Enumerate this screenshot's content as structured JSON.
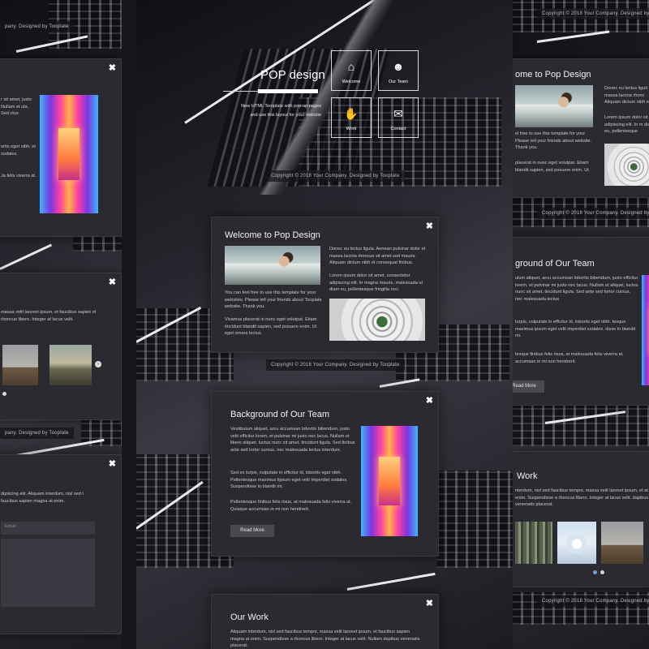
{
  "hero": {
    "title": "POP design",
    "tagline_1": "New HTML Template with pop up pages",
    "tagline_2": "and use this layout for your website",
    "nav": [
      {
        "label": "Welcome",
        "icon": "home-icon"
      },
      {
        "label": "Our Team",
        "icon": "users-icon"
      },
      {
        "label": "Work",
        "icon": "handshake-icon"
      },
      {
        "label": "Contact",
        "icon": "chat-icon"
      }
    ]
  },
  "footer": {
    "copyright": "Copyright © 2018 Your Company. Designed by Tooplate",
    "copyright_short_left": "pany. Designed by Tooplate",
    "copyright_right": "Copyright © 2018 Your Company. Designed by"
  },
  "welcome": {
    "title": "Welcome to Pop Design",
    "title_cut": "ome to Pop Design",
    "col1_p1": "You can feel free to use this template for your websites. Please tell your friends about Tooplate website. Thank you.",
    "col1_p1_cut": "el free to use this template for your Please tell your friends about website. Thank you.",
    "col1_p2": "Vivamus placerat in nunc eget volutpat. Etiam tincidunt blandit sapien, sed posuere enim. Ut eget ornare lectus.",
    "col1_p2_cut": "placerat in nunc eget volutpat. Etiam blandit sapien, sed posuere enim. Ut",
    "col2_p1": "Donec eu lectus ligula. Aenean pulvinar dolor et massa lacinia rhoncus sit amet sed mauris. Aliquam dictum nibh et consequat finibus.",
    "col2_p1_cut": "Donec eu lectus liguli massa lacinia rhonc Aliquam dictum nibh et",
    "col2_p2": "Lorem ipsum dolor sit amet, consectetur adipiscing elit. In magna mauris, malesuada ut diam eu, pellentesque fringilla orci.",
    "col2_p2_cut": "Lorem ipsum dolor sit adipiscing elit. In m diam eu, pellentesque"
  },
  "team": {
    "title": "Background of Our Team",
    "title_cut": "ground of Our Team",
    "p1": "Vestibulum aliquet, arcu accumsan lobortis bibendum, justo velit efficitur lorem, et pulvinar mi justo nec lacus. Nullam et libero aliquet, luctus nunc sit amet, tincidunt ligula. Sed finibus ante sed tortor cursus, nec malesuada lectus interdum.",
    "p1_cut": "ulum aliquet, arcu accumsan lobortis bibendum, justo efficitur lorem, et pulvinar mi justo nec lacus. Nullam et aliquet, luctus nunc sit amet, tincidunt ligula. Sed ante sed tortor cursus, nec malesuada lectus",
    "p2": "Sed ex turpis, vulputate in efficitur id, lobortis eget nibh. Pellentesque maximus lipsum eget velit imperdiet sodales. Suspendisse in blandit mi.",
    "p2_cut": "turpis, vulputate in efficitur id, lobortis eget nibh. tesque maximus ipsum eget velit imperdiet sodales. disse in blandit mi.",
    "p3": "Pellentesque finibus felis risus, at malesuada felis viverra at. Quisque accumsan in mi non hendrerit.",
    "p3_cut": "tesque finibus felis risus, at malesuada felis viverra at. accumsan in mi non hendrerit.",
    "button": "Read More",
    "left_cut": "r sit amet, justo Nullam et ula. Sed ctus",
    "left_cut2": "ortis eget nibh. et sodales.",
    "left_cut3": "Ja felis viverra at."
  },
  "work": {
    "title": "Our Work",
    "title_cut": "Work",
    "p1": "Aliquam interdum, nisl sed faucibus tempor, massa velit laoreet ipsum, et faucibus sapien magna at enim. Suspendisse a rhoncus libero. Integer at lacus velit. Nullam dapibus venenatis placerat.",
    "p1_cut": "nterdum, nisl sed faucibus tempor, massa velit laoreet ipsum, et at enim. Suspendisse a rhoncus libero. Integer at lacus velit. dapibus venenatis placerat.",
    "left_cut": "massa velit laoreet ipsum, et faucibus sapien el rhoncus libero. Integer at lacus velit."
  },
  "contact": {
    "left_cut": "dipiscing elit. Aliquam interdum, nisl sed t faucibus sapien magna at enim.",
    "email_placeholder": "Email"
  },
  "colors": {
    "background": "#17161c",
    "modal": "#2b2a31",
    "accent_dot": "#6fa0d8"
  }
}
